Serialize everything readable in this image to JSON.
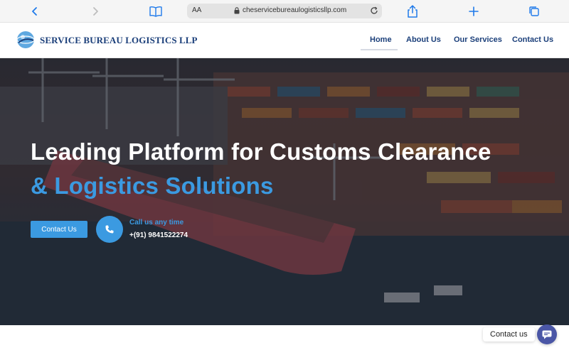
{
  "browser": {
    "text_size_label": "AA",
    "url": "cheservicebureaulogisticsllp.com",
    "icons": {
      "back": "chevron-left-icon",
      "forward": "chevron-right-icon",
      "bookmarks": "book-icon",
      "lock": "lock-icon",
      "reload": "reload-icon",
      "share": "share-icon",
      "new_tab": "plus-icon",
      "tabs": "tabs-icon"
    },
    "accent_color": "#1f7aea"
  },
  "header": {
    "brand_name": "SERVICE BUREAU LOGISTICS LLP",
    "brand_color": "#1b3f7a",
    "nav": [
      {
        "label": "Home",
        "active": true
      },
      {
        "label": "About Us",
        "active": false
      },
      {
        "label": "Our Services",
        "active": false
      },
      {
        "label": "Contact Us",
        "active": false
      }
    ]
  },
  "hero": {
    "headline_line1": "Leading Platform for Customs Clearance",
    "headline_line2": "& Logistics Solutions",
    "accent_color": "#3b9ae1",
    "cta_label": "Contact Us",
    "call_label": "Call us any time",
    "phone_number": "+(91) 9841522274",
    "background_image": "aerial view of container port with cargo ship"
  },
  "chat_widget": {
    "label": "Contact us",
    "icon": "chat-icon",
    "color": "#4a56a6"
  }
}
